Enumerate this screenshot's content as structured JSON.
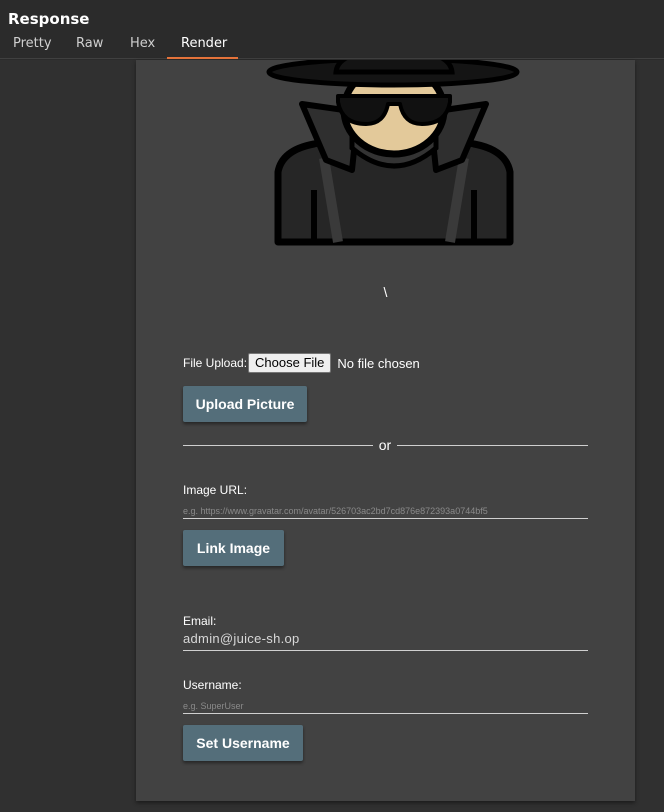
{
  "panel": {
    "title": "Response",
    "tabs": [
      {
        "label": "Pretty",
        "active": false
      },
      {
        "label": "Raw",
        "active": false
      },
      {
        "label": "Hex",
        "active": false
      },
      {
        "label": "Render",
        "active": true
      }
    ],
    "accent_color": "#e8743b"
  },
  "profile": {
    "avatar_icon": "hacker-avatar-icon",
    "username_display": "\\",
    "file_upload": {
      "label": "File Upload:",
      "button_label": "Choose File",
      "status": "No file chosen"
    },
    "upload_button_label": "Upload Picture",
    "divider_text": "or",
    "image_url": {
      "label": "Image URL:",
      "placeholder": "e.g. https://www.gravatar.com/avatar/526703ac2bd7cd876e872393a0744bf5"
    },
    "link_button_label": "Link Image",
    "email": {
      "label": "Email:",
      "value": "admin@juice-sh.op"
    },
    "username": {
      "label": "Username:",
      "placeholder": "e.g. SuperUser"
    },
    "set_username_button_label": "Set Username",
    "button_color": "#546e7a"
  }
}
